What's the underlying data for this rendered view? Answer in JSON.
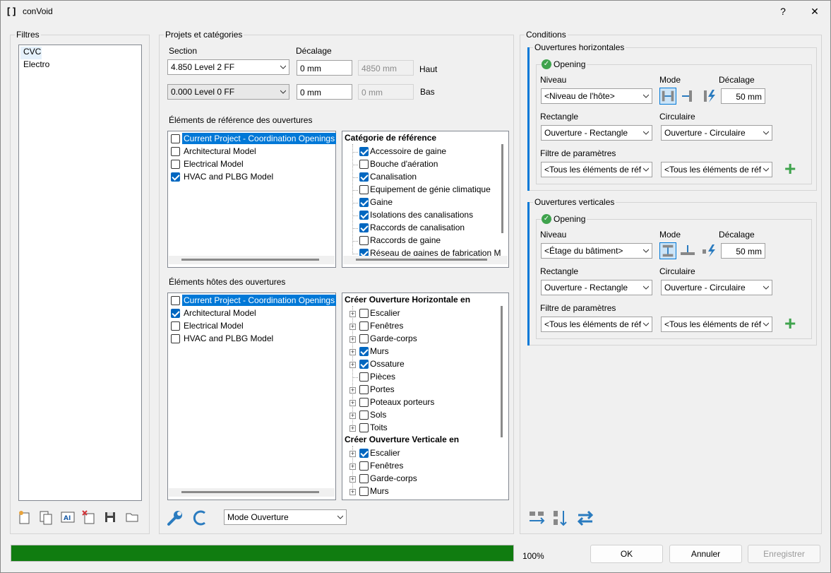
{
  "window": {
    "title": "conVoid",
    "help": "?",
    "close": "✕"
  },
  "filters": {
    "title": "Filtres",
    "items": [
      "CVC",
      "Electro"
    ]
  },
  "projects": {
    "title": "Projets et catégories",
    "section_label": "Section",
    "offset_label": "Décalage",
    "top_section": "4.850  Level 2 FF",
    "top_offset": "0 mm",
    "top_computed": "4850 mm",
    "top_label": "Haut",
    "bottom_section": "0.000  Level 0 FF",
    "bottom_offset": "0 mm",
    "bottom_computed": "0 mm",
    "bottom_label": "Bas"
  },
  "ref_elements": {
    "title": "Éléments de référence des ouvertures",
    "models": [
      {
        "label": "Current Project - Coordination Openings",
        "checked": false,
        "selected": true
      },
      {
        "label": "Architectural Model",
        "checked": false,
        "selected": false
      },
      {
        "label": "Electrical Model",
        "checked": false,
        "selected": false
      },
      {
        "label": "HVAC and PLBG Model",
        "checked": true,
        "selected": false
      }
    ],
    "category_header": "Catégorie de référence",
    "categories": [
      {
        "label": "Accessoire de gaine",
        "checked": true
      },
      {
        "label": "Bouche d'aération",
        "checked": false
      },
      {
        "label": "Canalisation",
        "checked": true
      },
      {
        "label": "Equipement de génie climatique",
        "checked": false
      },
      {
        "label": "Gaine",
        "checked": true
      },
      {
        "label": "Isolations des canalisations",
        "checked": true
      },
      {
        "label": "Raccords de canalisation",
        "checked": true
      },
      {
        "label": "Raccords de gaine",
        "checked": false
      },
      {
        "label": "Réseau de gaines de fabrication M",
        "checked": true
      }
    ]
  },
  "host_elements": {
    "title": "Éléments hôtes des ouvertures",
    "models": [
      {
        "label": "Current Project - Coordination Openings",
        "checked": false,
        "selected": true
      },
      {
        "label": "Architectural Model",
        "checked": true,
        "selected": false
      },
      {
        "label": "Electrical Model",
        "checked": false,
        "selected": false
      },
      {
        "label": "HVAC and PLBG Model",
        "checked": false,
        "selected": false
      }
    ],
    "horizontal_header": "Créer Ouverture Horizontale en",
    "horizontal": [
      {
        "label": "Escalier",
        "checked": false,
        "expandable": true
      },
      {
        "label": "Fenêtres",
        "checked": false,
        "expandable": true
      },
      {
        "label": "Garde-corps",
        "checked": false,
        "expandable": true
      },
      {
        "label": "Murs",
        "checked": true,
        "expandable": true
      },
      {
        "label": "Ossature",
        "checked": true,
        "expandable": true
      },
      {
        "label": "Pièces",
        "checked": false,
        "expandable": false
      },
      {
        "label": "Portes",
        "checked": false,
        "expandable": true
      },
      {
        "label": "Poteaux porteurs",
        "checked": false,
        "expandable": true
      },
      {
        "label": "Sols",
        "checked": false,
        "expandable": true
      },
      {
        "label": "Toits",
        "checked": false,
        "expandable": true
      }
    ],
    "vertical_header": "Créer Ouverture Verticale en",
    "vertical": [
      {
        "label": "Escalier",
        "checked": true,
        "expandable": true
      },
      {
        "label": "Fenêtres",
        "checked": false,
        "expandable": true
      },
      {
        "label": "Garde-corps",
        "checked": false,
        "expandable": true
      },
      {
        "label": "Murs",
        "checked": false,
        "expandable": true
      }
    ]
  },
  "mode_combo": "Mode Ouverture",
  "conditions": {
    "title": "Conditions",
    "horizontal": {
      "title": "Ouvertures horizontales",
      "opening": "Opening",
      "niveau_label": "Niveau",
      "mode_label": "Mode",
      "offset_label": "Décalage",
      "niveau": "<Niveau de l'hôte>",
      "offset": "50 mm",
      "rect_label": "Rectangle",
      "circ_label": "Circulaire",
      "rect": "Ouverture - Rectangle",
      "circ": "Ouverture - Circulaire",
      "filter_label": "Filtre de paramètres",
      "filter1": "<Tous les éléments de réf",
      "filter2": "<Tous les éléments de réf"
    },
    "vertical": {
      "title": "Ouvertures verticales",
      "opening": "Opening",
      "niveau_label": "Niveau",
      "mode_label": "Mode",
      "offset_label": "Décalage",
      "niveau": "<Étage du bâtiment>",
      "offset": "50 mm",
      "rect_label": "Rectangle",
      "circ_label": "Circulaire",
      "rect": "Ouverture - Rectangle",
      "circ": "Ouverture - Circulaire",
      "filter_label": "Filtre de paramètres",
      "filter1": "<Tous les éléments de réf",
      "filter2": "<Tous les éléments de réf"
    }
  },
  "progress": {
    "value": 1.0,
    "label": "100%",
    "color": "#107c10"
  },
  "buttons": {
    "ok": "OK",
    "cancel": "Annuler",
    "save": "Enregistrer"
  },
  "colors": {
    "accent": "#0078d7",
    "selection": "#0078d7",
    "check": "#0067c0",
    "green": "#3fa34d"
  }
}
